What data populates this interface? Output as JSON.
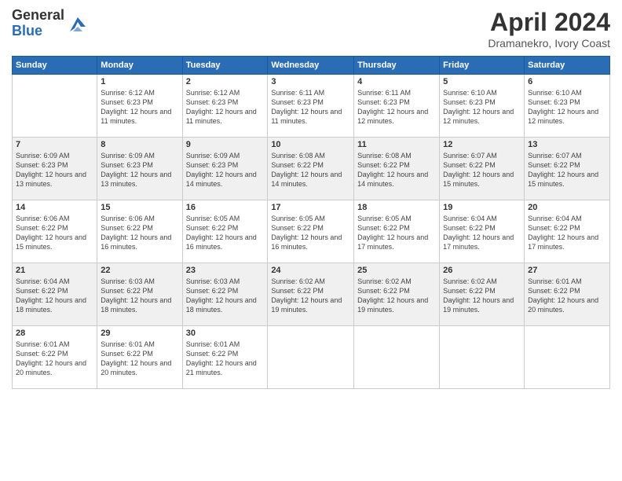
{
  "header": {
    "logo_general": "General",
    "logo_blue": "Blue",
    "title": "April 2024",
    "location": "Dramanekro, Ivory Coast"
  },
  "days_of_week": [
    "Sunday",
    "Monday",
    "Tuesday",
    "Wednesday",
    "Thursday",
    "Friday",
    "Saturday"
  ],
  "weeks": [
    [
      {
        "day": "",
        "sunrise": "",
        "sunset": "",
        "daylight": ""
      },
      {
        "day": "1",
        "sunrise": "Sunrise: 6:12 AM",
        "sunset": "Sunset: 6:23 PM",
        "daylight": "Daylight: 12 hours and 11 minutes."
      },
      {
        "day": "2",
        "sunrise": "Sunrise: 6:12 AM",
        "sunset": "Sunset: 6:23 PM",
        "daylight": "Daylight: 12 hours and 11 minutes."
      },
      {
        "day": "3",
        "sunrise": "Sunrise: 6:11 AM",
        "sunset": "Sunset: 6:23 PM",
        "daylight": "Daylight: 12 hours and 11 minutes."
      },
      {
        "day": "4",
        "sunrise": "Sunrise: 6:11 AM",
        "sunset": "Sunset: 6:23 PM",
        "daylight": "Daylight: 12 hours and 12 minutes."
      },
      {
        "day": "5",
        "sunrise": "Sunrise: 6:10 AM",
        "sunset": "Sunset: 6:23 PM",
        "daylight": "Daylight: 12 hours and 12 minutes."
      },
      {
        "day": "6",
        "sunrise": "Sunrise: 6:10 AM",
        "sunset": "Sunset: 6:23 PM",
        "daylight": "Daylight: 12 hours and 12 minutes."
      }
    ],
    [
      {
        "day": "7",
        "sunrise": "Sunrise: 6:09 AM",
        "sunset": "Sunset: 6:23 PM",
        "daylight": "Daylight: 12 hours and 13 minutes."
      },
      {
        "day": "8",
        "sunrise": "Sunrise: 6:09 AM",
        "sunset": "Sunset: 6:23 PM",
        "daylight": "Daylight: 12 hours and 13 minutes."
      },
      {
        "day": "9",
        "sunrise": "Sunrise: 6:09 AM",
        "sunset": "Sunset: 6:23 PM",
        "daylight": "Daylight: 12 hours and 14 minutes."
      },
      {
        "day": "10",
        "sunrise": "Sunrise: 6:08 AM",
        "sunset": "Sunset: 6:22 PM",
        "daylight": "Daylight: 12 hours and 14 minutes."
      },
      {
        "day": "11",
        "sunrise": "Sunrise: 6:08 AM",
        "sunset": "Sunset: 6:22 PM",
        "daylight": "Daylight: 12 hours and 14 minutes."
      },
      {
        "day": "12",
        "sunrise": "Sunrise: 6:07 AM",
        "sunset": "Sunset: 6:22 PM",
        "daylight": "Daylight: 12 hours and 15 minutes."
      },
      {
        "day": "13",
        "sunrise": "Sunrise: 6:07 AM",
        "sunset": "Sunset: 6:22 PM",
        "daylight": "Daylight: 12 hours and 15 minutes."
      }
    ],
    [
      {
        "day": "14",
        "sunrise": "Sunrise: 6:06 AM",
        "sunset": "Sunset: 6:22 PM",
        "daylight": "Daylight: 12 hours and 15 minutes."
      },
      {
        "day": "15",
        "sunrise": "Sunrise: 6:06 AM",
        "sunset": "Sunset: 6:22 PM",
        "daylight": "Daylight: 12 hours and 16 minutes."
      },
      {
        "day": "16",
        "sunrise": "Sunrise: 6:05 AM",
        "sunset": "Sunset: 6:22 PM",
        "daylight": "Daylight: 12 hours and 16 minutes."
      },
      {
        "day": "17",
        "sunrise": "Sunrise: 6:05 AM",
        "sunset": "Sunset: 6:22 PM",
        "daylight": "Daylight: 12 hours and 16 minutes."
      },
      {
        "day": "18",
        "sunrise": "Sunrise: 6:05 AM",
        "sunset": "Sunset: 6:22 PM",
        "daylight": "Daylight: 12 hours and 17 minutes."
      },
      {
        "day": "19",
        "sunrise": "Sunrise: 6:04 AM",
        "sunset": "Sunset: 6:22 PM",
        "daylight": "Daylight: 12 hours and 17 minutes."
      },
      {
        "day": "20",
        "sunrise": "Sunrise: 6:04 AM",
        "sunset": "Sunset: 6:22 PM",
        "daylight": "Daylight: 12 hours and 17 minutes."
      }
    ],
    [
      {
        "day": "21",
        "sunrise": "Sunrise: 6:04 AM",
        "sunset": "Sunset: 6:22 PM",
        "daylight": "Daylight: 12 hours and 18 minutes."
      },
      {
        "day": "22",
        "sunrise": "Sunrise: 6:03 AM",
        "sunset": "Sunset: 6:22 PM",
        "daylight": "Daylight: 12 hours and 18 minutes."
      },
      {
        "day": "23",
        "sunrise": "Sunrise: 6:03 AM",
        "sunset": "Sunset: 6:22 PM",
        "daylight": "Daylight: 12 hours and 18 minutes."
      },
      {
        "day": "24",
        "sunrise": "Sunrise: 6:02 AM",
        "sunset": "Sunset: 6:22 PM",
        "daylight": "Daylight: 12 hours and 19 minutes."
      },
      {
        "day": "25",
        "sunrise": "Sunrise: 6:02 AM",
        "sunset": "Sunset: 6:22 PM",
        "daylight": "Daylight: 12 hours and 19 minutes."
      },
      {
        "day": "26",
        "sunrise": "Sunrise: 6:02 AM",
        "sunset": "Sunset: 6:22 PM",
        "daylight": "Daylight: 12 hours and 19 minutes."
      },
      {
        "day": "27",
        "sunrise": "Sunrise: 6:01 AM",
        "sunset": "Sunset: 6:22 PM",
        "daylight": "Daylight: 12 hours and 20 minutes."
      }
    ],
    [
      {
        "day": "28",
        "sunrise": "Sunrise: 6:01 AM",
        "sunset": "Sunset: 6:22 PM",
        "daylight": "Daylight: 12 hours and 20 minutes."
      },
      {
        "day": "29",
        "sunrise": "Sunrise: 6:01 AM",
        "sunset": "Sunset: 6:22 PM",
        "daylight": "Daylight: 12 hours and 20 minutes."
      },
      {
        "day": "30",
        "sunrise": "Sunrise: 6:01 AM",
        "sunset": "Sunset: 6:22 PM",
        "daylight": "Daylight: 12 hours and 21 minutes."
      },
      {
        "day": "",
        "sunrise": "",
        "sunset": "",
        "daylight": ""
      },
      {
        "day": "",
        "sunrise": "",
        "sunset": "",
        "daylight": ""
      },
      {
        "day": "",
        "sunrise": "",
        "sunset": "",
        "daylight": ""
      },
      {
        "day": "",
        "sunrise": "",
        "sunset": "",
        "daylight": ""
      }
    ]
  ]
}
